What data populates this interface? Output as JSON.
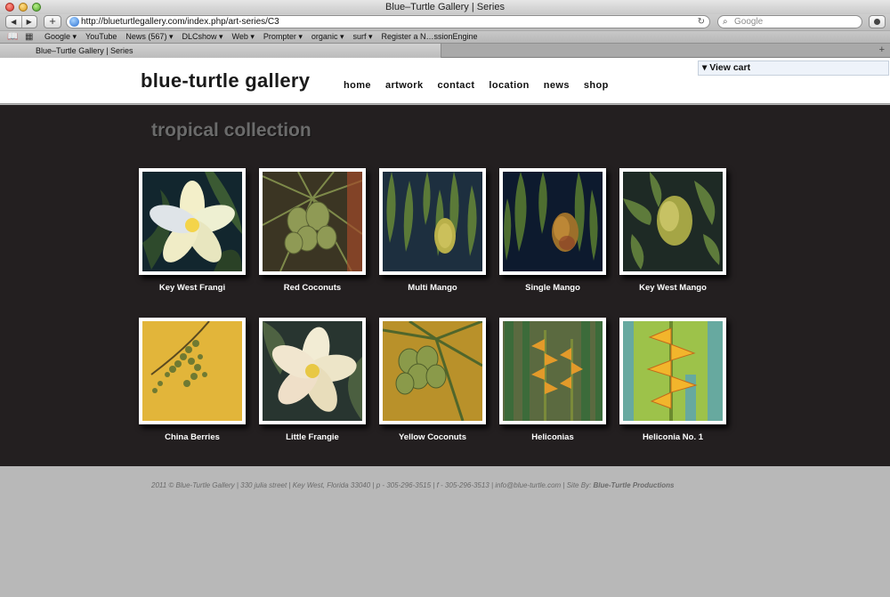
{
  "browser": {
    "window_title": "Blue–Turtle Gallery | Series",
    "url": "http://blueturtlegallery.com/index.php/art-series/C3",
    "search_placeholder": "Google",
    "back_glyph": "◀",
    "forward_glyph": "▶",
    "new_tab_glyph": "+",
    "reload_glyph": "↻",
    "search_glyph": "⌕",
    "bookmarks": [
      "Google ▾",
      "YouTube",
      "News (567) ▾",
      "DLCshow ▾",
      "Web ▾",
      "Prompter ▾",
      "organic ▾",
      "surf ▾",
      "Register a N…ssionEngine"
    ],
    "tab_title": "Blue–Turtle Gallery | Series",
    "add_tab_glyph": "+"
  },
  "site": {
    "logo": "blue-turtle gallery",
    "nav": [
      "home",
      "artwork",
      "contact",
      "location",
      "news",
      "shop"
    ],
    "view_cart": "▾ View cart"
  },
  "collection": {
    "title": "tropical collection",
    "items": [
      {
        "title": "Key West Frangi"
      },
      {
        "title": "Red Coconuts"
      },
      {
        "title": "Multi Mango"
      },
      {
        "title": "Single Mango"
      },
      {
        "title": "Key West Mango"
      },
      {
        "title": "China Berries"
      },
      {
        "title": "Little Frangie"
      },
      {
        "title": "Yellow Coconuts"
      },
      {
        "title": "Heliconias"
      },
      {
        "title": "Heliconia No. 1"
      }
    ]
  },
  "footer": {
    "text": "2011 © Blue-Turtle Gallery | 330 julia street | Key West, Florida 33040 | p - 305-296-3515 | f - 305-296-3513 | info@blue-turtle.com | Site By: ",
    "credit": "Blue-Turtle Productions"
  },
  "colors": {
    "page_background": "#231f20",
    "outer_background": "#b8b8b8",
    "title_grey": "#6b6b6b"
  }
}
